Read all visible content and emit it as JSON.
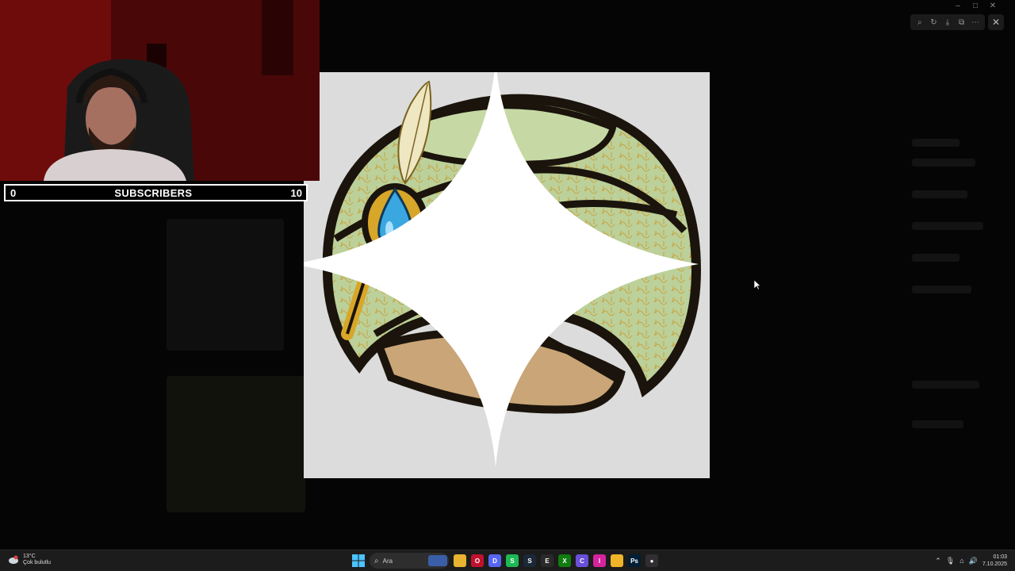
{
  "window": {
    "title": "",
    "controls": [
      "minimize-icon",
      "maximize-icon",
      "close-icon"
    ]
  },
  "viewer_toolbar": {
    "icons": [
      "zoom-icon",
      "rotate-icon",
      "download-icon",
      "open-external-icon",
      "more-icon"
    ],
    "close": "✕"
  },
  "overlay": {
    "subscriber_count": "0",
    "subscriber_label": "SUBSCRIBERS",
    "subscriber_goal": "10"
  },
  "taskbar": {
    "weather_temp": "13°C",
    "weather_desc": "Çok bulutlu",
    "search_placeholder": "Ara",
    "time": "01:03",
    "date": "7.10.2025",
    "apps": [
      {
        "name": "file-explorer-icon",
        "color": "#e8b331",
        "glyph": ""
      },
      {
        "name": "opera-icon",
        "color": "#c0122e",
        "glyph": "O"
      },
      {
        "name": "discord-icon",
        "color": "#5865f2",
        "glyph": "D"
      },
      {
        "name": "spotify-icon",
        "color": "#1db954",
        "glyph": "S"
      },
      {
        "name": "steam-icon",
        "color": "#1b2838",
        "glyph": "S"
      },
      {
        "name": "epic-icon",
        "color": "#2a2a2a",
        "glyph": "E"
      },
      {
        "name": "xbox-icon",
        "color": "#107c10",
        "glyph": "X"
      },
      {
        "name": "copilot-icon",
        "color": "#6a4fd8",
        "glyph": "C"
      },
      {
        "name": "instagram-icon",
        "color": "#d6249f",
        "glyph": "I"
      },
      {
        "name": "folder-icon",
        "color": "#f0b429",
        "glyph": ""
      },
      {
        "name": "photoshop-icon",
        "color": "#001e36",
        "glyph": "Ps"
      },
      {
        "name": "obs-icon",
        "color": "#302e31",
        "glyph": "●"
      }
    ]
  },
  "colors": {
    "turban_green": "#bcd09a",
    "turban_outline": "#1a140c",
    "gold": "#d8a628",
    "gem_blue": "#3aa7e0",
    "base_tan": "#c9a577",
    "image_bg": "#dcdcdc",
    "webcam_tint": "#7a0d0d"
  }
}
